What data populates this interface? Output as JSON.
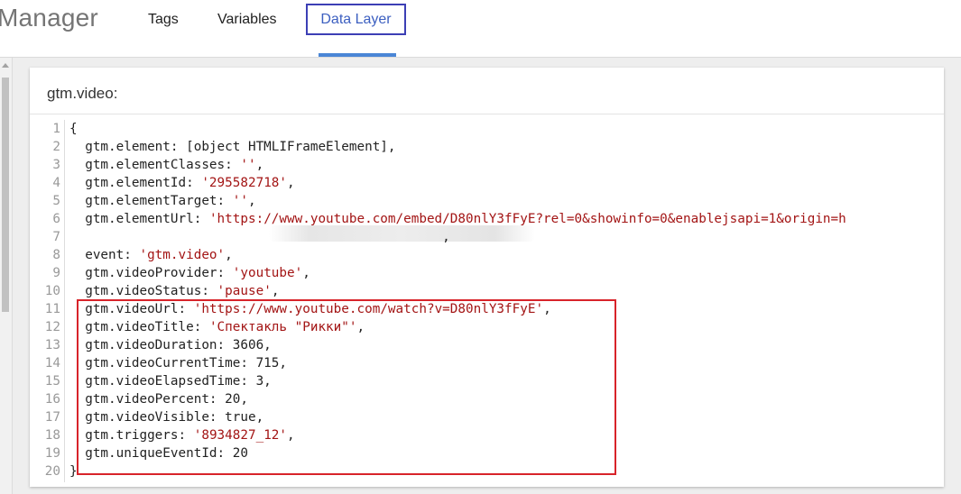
{
  "header": {
    "brand": "Manager",
    "tabs": [
      {
        "label": "Tags"
      },
      {
        "label": "Variables"
      },
      {
        "label": "Data Layer",
        "active": true
      }
    ]
  },
  "card": {
    "title": "gtm.video:",
    "lines": [
      {
        "n": "1",
        "parts": [
          {
            "t": "{"
          }
        ]
      },
      {
        "n": "2",
        "parts": [
          {
            "t": "  gtm.element: [object HTMLIFrameElement],"
          }
        ]
      },
      {
        "n": "3",
        "parts": [
          {
            "t": "  gtm.elementClasses: "
          },
          {
            "t": "''",
            "s": 1
          },
          {
            "t": ","
          }
        ]
      },
      {
        "n": "4",
        "parts": [
          {
            "t": "  gtm.elementId: "
          },
          {
            "t": "'295582718'",
            "s": 1
          },
          {
            "t": ","
          }
        ]
      },
      {
        "n": "5",
        "parts": [
          {
            "t": "  gtm.elementTarget: "
          },
          {
            "t": "''",
            "s": 1
          },
          {
            "t": ","
          }
        ]
      },
      {
        "n": "6",
        "parts": [
          {
            "t": "  gtm.elementUrl: "
          },
          {
            "t": "'https://www.youtube.com/embed/D80nlY3fFyE?rel=0&showinfo=0&enablejsapi=1&origin=h",
            "s": 1
          }
        ]
      },
      {
        "n": "7",
        "parts": [
          {
            "t": "                                                ,"
          }
        ]
      },
      {
        "n": "8",
        "parts": [
          {
            "t": "  event: "
          },
          {
            "t": "'gtm.video'",
            "s": 1
          },
          {
            "t": ","
          }
        ]
      },
      {
        "n": "9",
        "parts": [
          {
            "t": "  gtm.videoProvider: "
          },
          {
            "t": "'youtube'",
            "s": 1
          },
          {
            "t": ","
          }
        ]
      },
      {
        "n": "10",
        "parts": [
          {
            "t": "  gtm.videoStatus: "
          },
          {
            "t": "'pause'",
            "s": 1
          },
          {
            "t": ","
          }
        ]
      },
      {
        "n": "11",
        "parts": [
          {
            "t": "  gtm.videoUrl: "
          },
          {
            "t": "'https://www.youtube.com/watch?v=D80nlY3fFyE'",
            "s": 1
          },
          {
            "t": ","
          }
        ]
      },
      {
        "n": "12",
        "parts": [
          {
            "t": "  gtm.videoTitle: "
          },
          {
            "t": "'Спектакль \"Рикки\"'",
            "s": 1
          },
          {
            "t": ","
          }
        ]
      },
      {
        "n": "13",
        "parts": [
          {
            "t": "  gtm.videoDuration: 3606,"
          }
        ]
      },
      {
        "n": "14",
        "parts": [
          {
            "t": "  gtm.videoCurrentTime: 715,"
          }
        ]
      },
      {
        "n": "15",
        "parts": [
          {
            "t": "  gtm.videoElapsedTime: 3,"
          }
        ]
      },
      {
        "n": "16",
        "parts": [
          {
            "t": "  gtm.videoPercent: 20,"
          }
        ]
      },
      {
        "n": "17",
        "parts": [
          {
            "t": "  gtm.videoVisible: true,"
          }
        ]
      },
      {
        "n": "18",
        "parts": [
          {
            "t": "  gtm.triggers: "
          },
          {
            "t": "'8934827_12'",
            "s": 1
          },
          {
            "t": ","
          }
        ]
      },
      {
        "n": "19",
        "parts": [
          {
            "t": "  gtm.uniqueEventId: 20"
          }
        ]
      },
      {
        "n": "20",
        "parts": [
          {
            "t": "}"
          }
        ]
      }
    ]
  },
  "colors": {
    "accent": "#4a86d6",
    "highlight_border": "#d8232a",
    "string": "#a31515"
  }
}
